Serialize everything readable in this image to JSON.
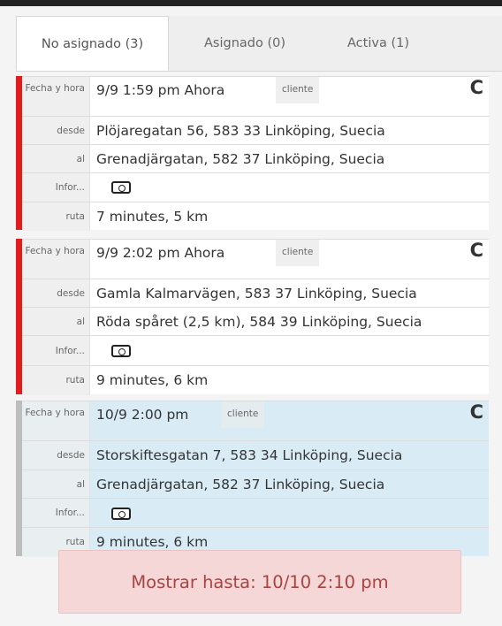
{
  "tabs": [
    {
      "label": "No asignado (3)"
    },
    {
      "label": "Asignado (0)"
    },
    {
      "label": "Activa (1)"
    }
  ],
  "row_labels": {
    "fecha": "Fecha y hora",
    "desde": "desde",
    "al": "al",
    "info": "Infor...",
    "ruta": "ruta"
  },
  "trips": [
    {
      "fecha": "9/9 1:59 pm Ahora",
      "badge": "cliente",
      "desde": "Plöjaregatan 56, 583 33 Linköping, Suecia",
      "al": "Grenadjärgatan, 582 37 Linköping, Suecia",
      "ruta": "7 minutes, 5 km",
      "accent": "#e11d1d"
    },
    {
      "fecha": "9/9 2:02 pm Ahora",
      "badge": "cliente",
      "desde": "Gamla Kalmarvägen, 583 37 Linköping, Suecia",
      "al": "Röda spåret (2,5 km), 584 39 Linköping, Suecia",
      "ruta": "9 minutes, 6 km",
      "accent": "#e11d1d"
    },
    {
      "fecha": "10/9 2:00 pm",
      "badge": "cliente",
      "desde": "Storskiftesgatan 7, 583 34 Linköping, Suecia",
      "al": "Grenadjärgatan, 582 37 Linköping, Suecia",
      "ruta": "9 minutes, 6 km",
      "accent": "#bdbdbd"
    }
  ],
  "footer": {
    "label": "Mostrar hasta: 10/10 2:10 pm"
  },
  "colors": {
    "alert": "#e11d1d",
    "highlight_bg": "#d9ecf6",
    "footer_bg": "#f6d7d7",
    "footer_text": "#a94442"
  },
  "icons": {
    "assign": "hook-icon",
    "camera": "camera-icon"
  }
}
